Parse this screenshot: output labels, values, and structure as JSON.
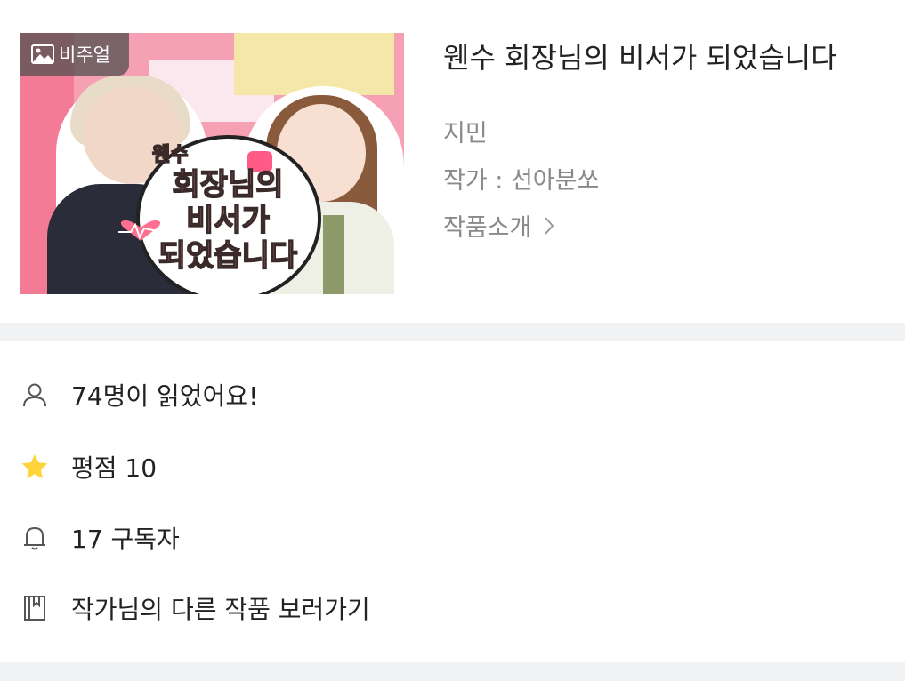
{
  "cover": {
    "badge_label": "비주얼",
    "title_art_line1": "웬수",
    "title_art_line2": "회장님의",
    "title_art_line3": "비서가",
    "title_art_line4": "되었습니다"
  },
  "book": {
    "title": "웬수 회장님의 비서가 되었습니다",
    "genre": "지민",
    "author": "작가 : 선아분쏘",
    "intro_link": "작품소개"
  },
  "stats": {
    "readers": "74명이 읽었어요!",
    "rating": "평점 10",
    "subscribers": "17 구독자",
    "other_works": "작가님의 다른 작품 보러가기"
  },
  "colors": {
    "star": "#FFD43B",
    "divider": "#F1F2F3",
    "meta_gray": "#8A8A8A"
  },
  "icons": [
    "image-icon",
    "chevron-right-icon",
    "person-icon",
    "star-icon",
    "bell-icon",
    "book-icon"
  ]
}
